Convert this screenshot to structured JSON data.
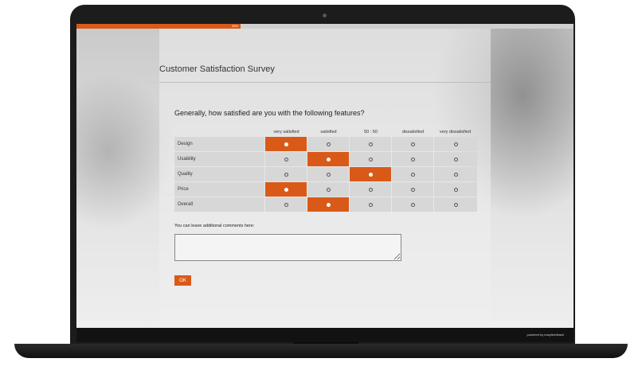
{
  "progress": {
    "percent": 33,
    "label": "33%"
  },
  "survey": {
    "title": "Customer Satisfaction Survey"
  },
  "question": {
    "text": "Generally, how satisfied are you with the following features?"
  },
  "matrix": {
    "columns": [
      "very satisfied",
      "satisfied",
      "50 : 50",
      "dissatisfied",
      "very dissatisfied"
    ],
    "rows": [
      {
        "label": "Design",
        "selected": 0
      },
      {
        "label": "Usability",
        "selected": 1
      },
      {
        "label": "Quality",
        "selected": 2
      },
      {
        "label": "Price",
        "selected": 0
      },
      {
        "label": "Overall",
        "selected": 1
      }
    ]
  },
  "comments": {
    "label": "You can leave additional comments here:",
    "value": ""
  },
  "actions": {
    "ok_label": "OK"
  },
  "footer": {
    "credit": "powered by easyfeedback"
  },
  "colors": {
    "accent": "#d95a18",
    "cell": "#d7d7d7"
  }
}
